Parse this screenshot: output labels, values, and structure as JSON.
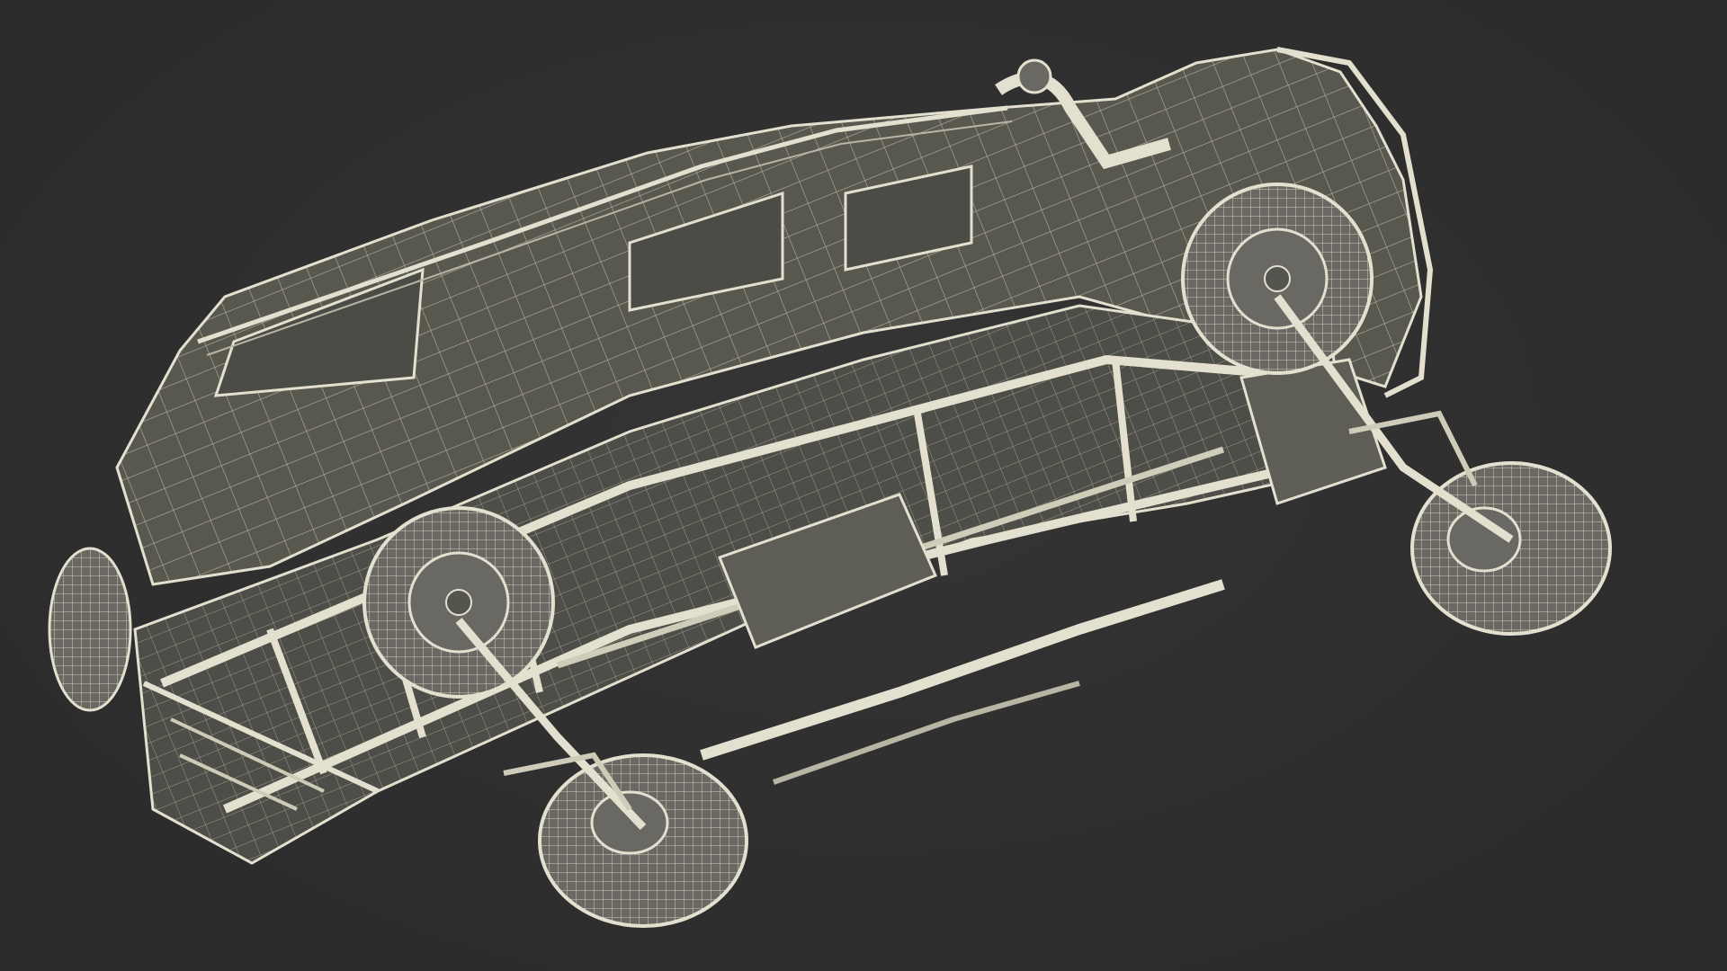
{
  "scene": {
    "subject": "wireframe-vehicle-underside",
    "background_color": "#2f2f2f",
    "body_color": "#5a5a55",
    "body_dark_color": "#4a4a46",
    "wire_color": "#e4e0cf",
    "wire_dim_color": "#b9b5a4",
    "tire_color": "#6a6862"
  }
}
